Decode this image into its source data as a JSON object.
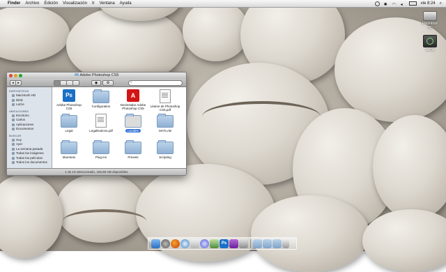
{
  "menubar": {
    "apple": "",
    "items": [
      "Finder",
      "Archivo",
      "Edición",
      "Visualización",
      "Ir",
      "Ventana",
      "Ayuda"
    ],
    "clock": "vie 8:24"
  },
  "desktop_icons": [
    {
      "label": "Macintosh HD",
      "icon": "hard-drive-icon"
    },
    {
      "label": "LaCie",
      "icon": "time-machine-drive-icon"
    }
  ],
  "window": {
    "title": "Adobe Photoshop CS5",
    "search_placeholder": "",
    "sidebar": [
      {
        "heading": "DISPOSITIVOS",
        "items": [
          "Macintosh HD",
          "iDisk",
          "LaCie"
        ]
      },
      {
        "heading": "UBICACIONES",
        "items": [
          "Escritorio",
          "Carlos",
          "Aplicaciones",
          "Documentos"
        ]
      },
      {
        "heading": "BUSCAR",
        "items": [
          "Hoy",
          "Ayer",
          "La semana pasada",
          "Todas las imágenes",
          "Todas las películas",
          "Todos los documentos"
        ]
      }
    ],
    "files": [
      {
        "label": "Adobe Photoshop CS5",
        "type": "ps-app"
      },
      {
        "label": "Configuration",
        "type": "folder"
      },
      {
        "label": "Desinstalar Adobe Photoshop CS5",
        "type": "adobe-app"
      },
      {
        "label": "Léame de Photoshop CS5.pdf",
        "type": "pdf"
      },
      {
        "label": "Legal",
        "type": "folder"
      },
      {
        "label": "LegalNotices.pdf",
        "type": "pdf"
      },
      {
        "label": "Locales",
        "type": "folder",
        "selected": true
      },
      {
        "label": "MATLAB",
        "type": "folder"
      },
      {
        "label": "Muestras",
        "type": "folder"
      },
      {
        "label": "Plug-ins",
        "type": "folder"
      },
      {
        "label": "Presets",
        "type": "folder"
      },
      {
        "label": "Scripting",
        "type": "folder"
      }
    ],
    "status": "1 de 13 seleccionado, 425,85 GB disponibles"
  },
  "dock": {
    "icons": [
      "finder-icon",
      "system-preferences-icon",
      "firefox-icon",
      "safari-icon",
      "mail-icon",
      "itunes-icon",
      "iphoto-icon",
      "photoshop-icon",
      "purple-app-icon",
      "preview-icon",
      "applications-folder-icon",
      "documents-folder-icon",
      "downloads-folder-icon",
      "trash-icon"
    ]
  }
}
